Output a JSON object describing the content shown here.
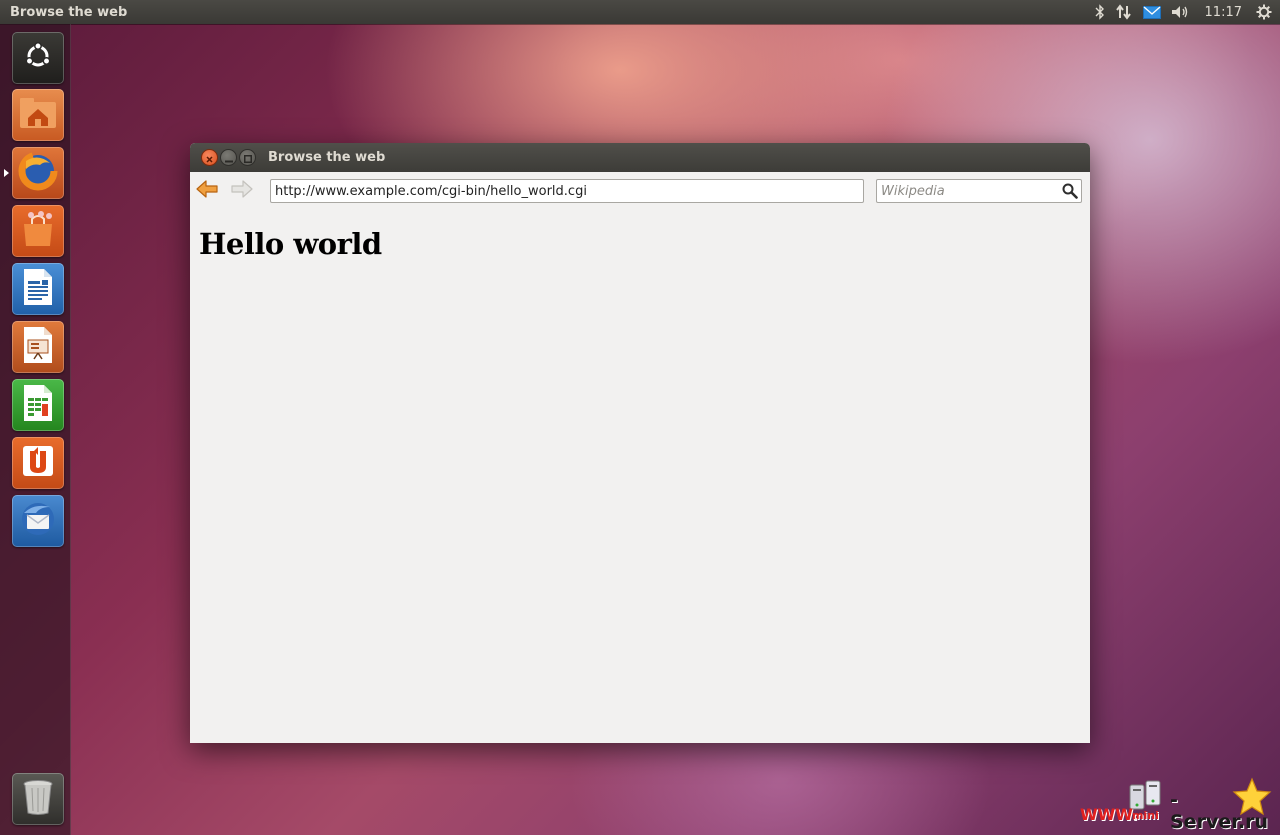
{
  "top_panel": {
    "app_title": "Browse the web",
    "clock": "11:17",
    "indicators": [
      "bluetooth-icon",
      "network-icon",
      "mail-icon",
      "volume-icon",
      "settings-gear-icon"
    ]
  },
  "launcher": {
    "items": [
      {
        "name": "dash-home",
        "icon": "ubuntu-logo-icon"
      },
      {
        "name": "home-folder",
        "icon": "home-folder-icon"
      },
      {
        "name": "firefox",
        "icon": "firefox-icon",
        "running": true
      },
      {
        "name": "software-center",
        "icon": "shopping-bag-icon"
      },
      {
        "name": "libreoffice-writer",
        "icon": "writer-document-icon"
      },
      {
        "name": "libreoffice-impress",
        "icon": "impress-presentation-icon"
      },
      {
        "name": "libreoffice-calc",
        "icon": "calc-spreadsheet-icon"
      },
      {
        "name": "ubuntu-one",
        "icon": "ubuntu-one-icon"
      },
      {
        "name": "thunderbird",
        "icon": "thunderbird-icon"
      },
      {
        "name": "trash",
        "icon": "trash-icon"
      }
    ]
  },
  "window": {
    "title": "Browse the web",
    "url": "http://www.example.com/cgi-bin/hello_world.cgi",
    "search_placeholder": "Wikipedia",
    "page_heading": "Hello world"
  },
  "watermark": {
    "www": "WWW.",
    "mini": "mini",
    "server": "-Server.ru"
  },
  "colors": {
    "panel": "#3c3b37",
    "close_button": "#e05a27",
    "window_bg": "#f2f1f0",
    "back_arrow": "#e88b2e"
  }
}
